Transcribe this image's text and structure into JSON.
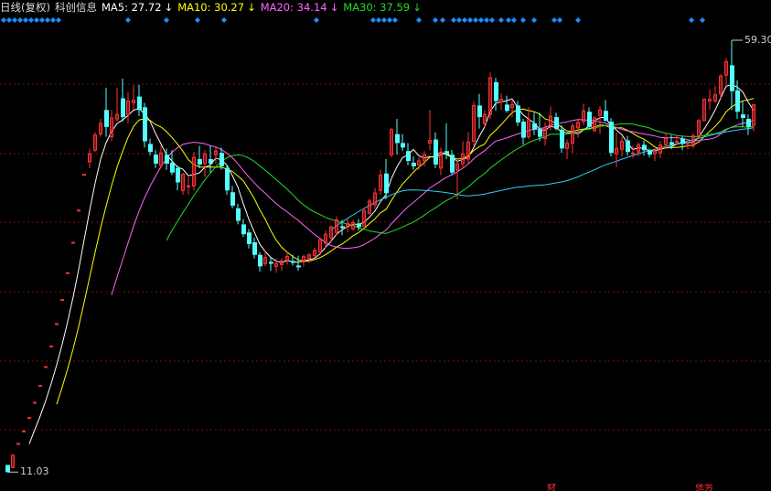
{
  "header": {
    "title": "日线(复权)",
    "stock_name": "科创信息",
    "ma5": "MA5: 27.72",
    "ma10": "MA10: 30.27",
    "ma20": "MA20: 34.14",
    "ma30": "MA30: 37.59",
    "down_arrow": "↓"
  },
  "markers": {
    "high": "59.30",
    "low": "11.03",
    "bottom_left": "财",
    "bottom_right": "张务"
  },
  "colors": {
    "up": "#ff3232",
    "down": "#54ffff",
    "ma5": "#ffffff",
    "ma10": "#ffff00",
    "ma20": "#ff66ff",
    "ma30": "#22dd22",
    "ma60": "#33ccff",
    "grid": "#7a1010",
    "diamond": "#1e8fff"
  },
  "chart_data": {
    "type": "candlestick",
    "y_range": [
      11.03,
      59.3
    ],
    "x_range": [
      0,
      134
    ],
    "indicators": [
      "MA5",
      "MA10",
      "MA20",
      "MA30",
      "MA60"
    ],
    "ohlc": [
      [
        11.8,
        11.8,
        11.0,
        11.0
      ],
      [
        11.5,
        12.9,
        11.5,
        12.9
      ],
      [
        14.2,
        14.2,
        14.2,
        14.2
      ],
      [
        15.6,
        15.6,
        15.6,
        15.6
      ],
      [
        17.1,
        17.1,
        17.1,
        17.1
      ],
      [
        18.8,
        18.8,
        18.8,
        18.8
      ],
      [
        20.7,
        20.7,
        20.7,
        20.7
      ],
      [
        22.8,
        22.8,
        22.8,
        22.8
      ],
      [
        25.1,
        25.1,
        25.1,
        25.1
      ],
      [
        27.6,
        27.6,
        27.6,
        27.6
      ],
      [
        30.3,
        30.3,
        30.3,
        30.3
      ],
      [
        33.3,
        33.3,
        33.3,
        33.3
      ],
      [
        36.7,
        36.7,
        36.7,
        36.7
      ],
      [
        40.3,
        40.3,
        40.3,
        40.3
      ],
      [
        44.3,
        44.3,
        44.3,
        44.3
      ],
      [
        45.7,
        47.2,
        45.0,
        46.6
      ],
      [
        47.0,
        49.0,
        46.8,
        48.7
      ],
      [
        48.8,
        50.5,
        48.5,
        50.0
      ],
      [
        51.5,
        54.0,
        48.5,
        49.6
      ],
      [
        48.5,
        51.5,
        48.0,
        50.6
      ],
      [
        50.5,
        54.0,
        50.2,
        51.0
      ],
      [
        52.8,
        55.0,
        50.2,
        50.7
      ],
      [
        51.0,
        53.5,
        50.0,
        52.5
      ],
      [
        52.3,
        54.3,
        51.5,
        52.6
      ],
      [
        53.0,
        54.3,
        50.8,
        51.5
      ],
      [
        51.8,
        52.3,
        47.3,
        48.0
      ],
      [
        47.7,
        48.3,
        46.4,
        46.8
      ],
      [
        46.5,
        47.0,
        45.0,
        45.5
      ],
      [
        45.3,
        47.5,
        45.0,
        46.7
      ],
      [
        46.5,
        47.2,
        44.8,
        45.5
      ],
      [
        45.6,
        47.0,
        44.2,
        44.5
      ],
      [
        45.0,
        45.3,
        42.5,
        43.4
      ],
      [
        42.5,
        44.5,
        42.0,
        44.3
      ],
      [
        43.0,
        44.0,
        42.0,
        43.0
      ],
      [
        43.0,
        46.8,
        42.5,
        46.2
      ],
      [
        46.0,
        47.5,
        45.0,
        45.4
      ],
      [
        45.5,
        47.0,
        44.0,
        46.6
      ],
      [
        46.0,
        47.5,
        44.5,
        45.5
      ],
      [
        46.5,
        47.3,
        45.5,
        46.9
      ],
      [
        46.7,
        47.3,
        44.8,
        45.2
      ],
      [
        45.0,
        45.4,
        42.0,
        42.5
      ],
      [
        42.3,
        43.0,
        40.5,
        40.8
      ],
      [
        40.5,
        41.0,
        38.7,
        39.1
      ],
      [
        38.7,
        39.3,
        37.3,
        37.6
      ],
      [
        37.8,
        38.2,
        36.0,
        36.5
      ],
      [
        36.7,
        37.2,
        34.9,
        35.3
      ],
      [
        35.3,
        35.6,
        33.4,
        34.0
      ],
      [
        34.3,
        35.8,
        34.0,
        35.0
      ],
      [
        34.5,
        35.0,
        33.5,
        34.3
      ],
      [
        34.0,
        34.9,
        33.3,
        34.3
      ],
      [
        34.2,
        34.9,
        33.5,
        34.6
      ],
      [
        34.7,
        35.6,
        34.2,
        35.1
      ],
      [
        34.6,
        35.3,
        34.1,
        34.4
      ],
      [
        34.1,
        35.2,
        33.5,
        33.9
      ],
      [
        34.5,
        35.3,
        34.0,
        35.1
      ],
      [
        34.9,
        35.5,
        34.4,
        35.3
      ],
      [
        35.2,
        36.1,
        34.9,
        35.8
      ],
      [
        35.6,
        37.2,
        35.4,
        37.0
      ],
      [
        36.6,
        38.0,
        36.1,
        37.6
      ],
      [
        37.2,
        38.6,
        36.8,
        38.4
      ],
      [
        37.8,
        39.6,
        37.5,
        39.2
      ],
      [
        38.5,
        39.2,
        37.5,
        38.3
      ],
      [
        38.4,
        39.4,
        37.8,
        38.8
      ],
      [
        38.2,
        39.2,
        38.0,
        38.9
      ],
      [
        38.8,
        39.3,
        38.0,
        38.4
      ],
      [
        38.5,
        40.4,
        38.5,
        40.2
      ],
      [
        39.9,
        41.6,
        39.9,
        41.3
      ],
      [
        40.9,
        42.8,
        40.5,
        42.2
      ],
      [
        42.5,
        44.8,
        42.0,
        44.2
      ],
      [
        44.4,
        46.0,
        41.5,
        42.2
      ],
      [
        46.5,
        49.5,
        46.2,
        49.3
      ],
      [
        48.8,
        50.5,
        46.5,
        47.8
      ],
      [
        47.8,
        48.8,
        46.9,
        47.3
      ],
      [
        46.9,
        47.8,
        45.3,
        45.8
      ],
      [
        45.6,
        46.3,
        44.8,
        45.2
      ],
      [
        45.4,
        46.2,
        44.8,
        45.8
      ],
      [
        45.8,
        46.9,
        45.2,
        46.5
      ],
      [
        47.8,
        51.5,
        47.0,
        48.1
      ],
      [
        48.2,
        49.0,
        45.0,
        45.4
      ],
      [
        45.0,
        47.3,
        44.2,
        46.8
      ],
      [
        46.9,
        50.0,
        46.0,
        46.5
      ],
      [
        46.5,
        47.0,
        44.2,
        44.5
      ],
      [
        44.8,
        46.0,
        41.5,
        45.5
      ],
      [
        45.5,
        48.0,
        45.0,
        46.6
      ],
      [
        46.0,
        49.0,
        45.5,
        47.9
      ],
      [
        48.0,
        52.5,
        47.5,
        52.0
      ],
      [
        52.0,
        53.3,
        49.4,
        50.7
      ],
      [
        50.0,
        51.5,
        49.6,
        51.0
      ],
      [
        51.0,
        55.7,
        50.5,
        55.1
      ],
      [
        54.6,
        55.1,
        51.4,
        52.5
      ],
      [
        52.4,
        53.4,
        51.5,
        52.7
      ],
      [
        52.1,
        53.1,
        51.2,
        51.4
      ],
      [
        51.8,
        52.8,
        50.7,
        52.1
      ],
      [
        52.0,
        52.5,
        49.7,
        50.1
      ],
      [
        50.2,
        50.5,
        47.6,
        48.4
      ],
      [
        48.5,
        51.8,
        48.2,
        50.4
      ],
      [
        50.0,
        51.2,
        48.7,
        49.3
      ],
      [
        49.3,
        51.2,
        48.0,
        48.5
      ],
      [
        48.3,
        50.1,
        47.5,
        49.5
      ],
      [
        49.8,
        51.9,
        49.2,
        50.8
      ],
      [
        50.7,
        51.2,
        49.2,
        49.4
      ],
      [
        49.3,
        49.8,
        46.7,
        47.2
      ],
      [
        47.2,
        48.2,
        46.0,
        47.8
      ],
      [
        47.8,
        50.0,
        46.7,
        49.7
      ],
      [
        49.5,
        50.5,
        48.4,
        50.1
      ],
      [
        50.2,
        52.2,
        49.8,
        51.4
      ],
      [
        51.3,
        51.8,
        49.3,
        49.6
      ],
      [
        49.2,
        50.8,
        49.0,
        50.6
      ],
      [
        50.9,
        51.9,
        48.8,
        51.5
      ],
      [
        51.4,
        52.6,
        50.2,
        50.3
      ],
      [
        50.2,
        50.6,
        46.3,
        46.7
      ],
      [
        46.6,
        49.0,
        45.1,
        47.2
      ],
      [
        47.1,
        48.5,
        46.3,
        48.0
      ],
      [
        48.1,
        48.6,
        46.4,
        46.8
      ],
      [
        46.6,
        47.5,
        46.1,
        46.7
      ],
      [
        46.8,
        47.9,
        46.3,
        47.6
      ],
      [
        47.6,
        48.1,
        46.4,
        47.0
      ],
      [
        47.0,
        47.2,
        46.2,
        46.5
      ],
      [
        46.6,
        47.2,
        45.8,
        46.9
      ],
      [
        46.7,
        48.0,
        46.1,
        47.6
      ],
      [
        47.6,
        48.9,
        47.1,
        48.3
      ],
      [
        47.9,
        48.7,
        47.1,
        47.6
      ],
      [
        47.9,
        48.7,
        47.6,
        48.0
      ],
      [
        48.3,
        48.6,
        47.0,
        47.7
      ],
      [
        47.5,
        48.2,
        47.1,
        47.6
      ],
      [
        47.5,
        48.9,
        47.2,
        48.6
      ],
      [
        48.6,
        50.5,
        48.3,
        50.3
      ],
      [
        50.3,
        52.8,
        50.3,
        52.7
      ],
      [
        52.5,
        53.8,
        51.5,
        52.7
      ],
      [
        52.5,
        54.2,
        52.3,
        53.2
      ],
      [
        53.3,
        55.5,
        52.8,
        55.3
      ],
      [
        55.4,
        57.3,
        54.3,
        56.9
      ],
      [
        56.5,
        59.3,
        51.5,
        53.6
      ],
      [
        53.7,
        54.8,
        50.5,
        51.3
      ],
      [
        51.0,
        52.5,
        49.6,
        50.6
      ],
      [
        50.5,
        51.0,
        48.7,
        49.6
      ],
      [
        49.8,
        52.1,
        49.1,
        52.1
      ]
    ]
  }
}
